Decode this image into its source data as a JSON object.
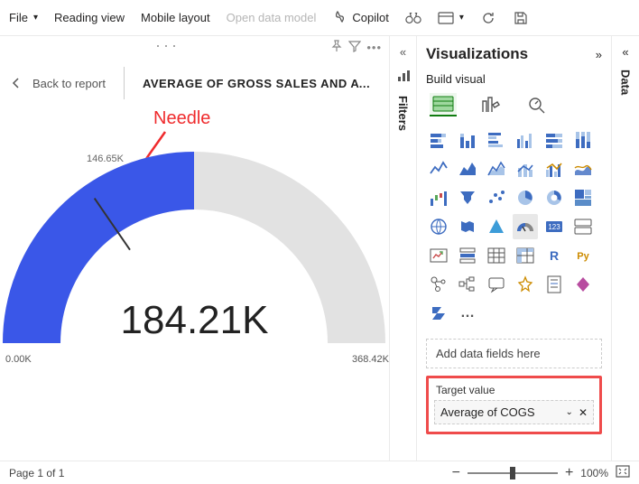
{
  "toolbar": {
    "file": "File",
    "reading_view": "Reading view",
    "mobile_layout": "Mobile layout",
    "open_data_model": "Open data model",
    "copilot": "Copilot"
  },
  "header": {
    "back": "Back to report",
    "title": "AVERAGE OF GROSS SALES AND AVERAG…"
  },
  "annotation": {
    "needle": "Needle"
  },
  "gauge": {
    "tick_label": "146.65K",
    "value": "184.21K",
    "min": "0.00K",
    "max": "368.42K"
  },
  "filters_pane": {
    "label": "Filters"
  },
  "viz_pane": {
    "title": "Visualizations",
    "subtitle": "Build visual",
    "more": "…",
    "wells": {
      "add_fields": "Add data fields here",
      "target_label": "Target value",
      "target_field": "Average of COGS"
    }
  },
  "data_pane": {
    "label": "Data"
  },
  "status": {
    "page": "Page 1 of 1",
    "zoom": "100%"
  },
  "chart_data": {
    "type": "gauge",
    "title": "AVERAGE OF GROSS SALES AND AVERAGE OF COGS",
    "value": 184.21,
    "target": 146.65,
    "min": 0.0,
    "max": 368.42,
    "unit": "K",
    "fill_color": "#3a57e8",
    "track_color": "#e2e2e2"
  }
}
